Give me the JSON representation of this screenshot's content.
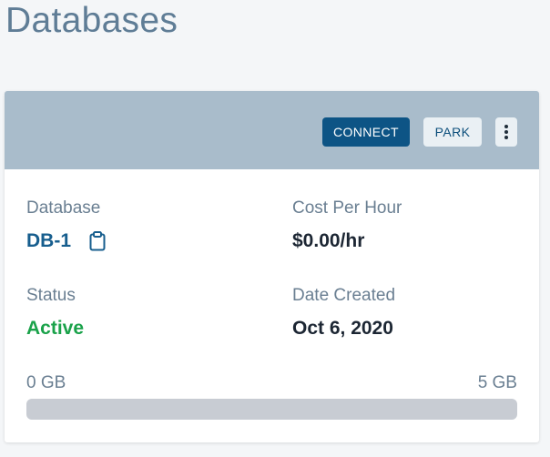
{
  "page": {
    "title": "Databases"
  },
  "card": {
    "actions": {
      "connect_label": "CONNECT",
      "park_label": "PARK",
      "more_icon": "vertical-ellipsis-icon"
    },
    "database": {
      "label": "Database",
      "value": "DB-1",
      "copy_icon": "clipboard-icon"
    },
    "cost": {
      "label": "Cost Per Hour",
      "value": "$0.00/hr"
    },
    "status": {
      "label": "Status",
      "value": "Active"
    },
    "date_created": {
      "label": "Date Created",
      "value": "Oct 6, 2020"
    },
    "storage": {
      "min_label": "0 GB",
      "max_label": "5 GB",
      "used_fraction": 0
    }
  },
  "colors": {
    "title": "#5f7d96",
    "header_bg": "#a9bccb",
    "primary_button": "#0d5485",
    "secondary_button": "#eaf0f4",
    "db_name": "#175e8e",
    "status_active": "#1aa24a",
    "progress_track": "#c8ccd3"
  }
}
